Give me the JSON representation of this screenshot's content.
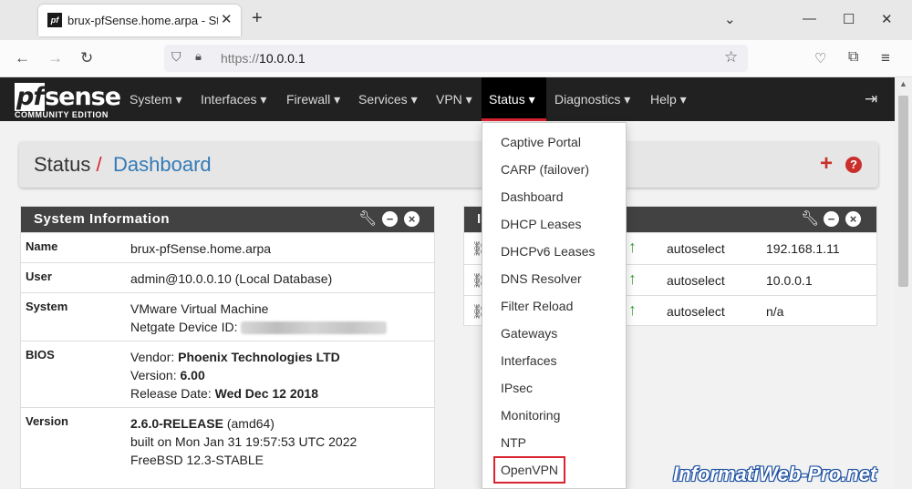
{
  "browser": {
    "tab_title": "brux-pfSense.home.arpa - Status",
    "favicon": "pf",
    "new_tab": "+",
    "minimize": "⌄",
    "url_proto": "https://",
    "url_host": "10.0.0.1"
  },
  "header": {
    "logo_text": "sense",
    "logo_pf": "pf",
    "logo_sub": "COMMUNITY EDITION",
    "menu": [
      "System ▾",
      "Interfaces ▾",
      "Firewall ▾",
      "Services ▾",
      "VPN ▾",
      "Status ▾",
      "Diagnostics ▾",
      "Help ▾"
    ],
    "active_menu": "Status ▾"
  },
  "breadcrumb": {
    "section": "Status",
    "separator": " / ",
    "page": "Dashboard"
  },
  "system_info": {
    "title": "System Information",
    "rows": [
      {
        "label": "Name",
        "lines": [
          "brux-pfSense.home.arpa"
        ]
      },
      {
        "label": "User",
        "lines": [
          "admin@10.0.0.10 (Local Database)"
        ]
      },
      {
        "label": "System",
        "line1": "VMware Virtual Machine",
        "line2_prefix": "Netgate Device ID:"
      },
      {
        "label": "BIOS",
        "vendor_prefix": "Vendor: ",
        "vendor": "Phoenix Technologies LTD",
        "version_prefix": "Version: ",
        "version": "6.00",
        "release_prefix": "Release Date: ",
        "release": "Wed Dec 12 2018"
      },
      {
        "label": "Version",
        "version": "2.6.0-RELEASE",
        "arch": " (amd64)",
        "built": "built on Mon Jan 31 19:57:53 UTC 2022",
        "os": "FreeBSD 12.3-STABLE"
      }
    ]
  },
  "interfaces": {
    "title": "I",
    "rows": [
      {
        "media": "autoselect",
        "ip": "192.168.1.11"
      },
      {
        "media": "autoselect",
        "ip": "10.0.0.1"
      },
      {
        "media": "autoselect",
        "ip": "n/a"
      }
    ]
  },
  "status_menu": {
    "items": [
      "Captive Portal",
      "CARP (failover)",
      "Dashboard",
      "DHCP Leases",
      "DHCPv6 Leases",
      "DNS Resolver",
      "Filter Reload",
      "Gateways",
      "Interfaces",
      "IPsec",
      "Monitoring",
      "NTP",
      "OpenVPN"
    ],
    "highlighted": "OpenVPN"
  },
  "watermark": "InformatiWeb-Pro.net",
  "colors": {
    "brand_red": "#d9232f",
    "header_bg": "#212121",
    "widget_head": "#424242",
    "link_blue": "#337ab7",
    "status_up": "#3ca43c"
  }
}
